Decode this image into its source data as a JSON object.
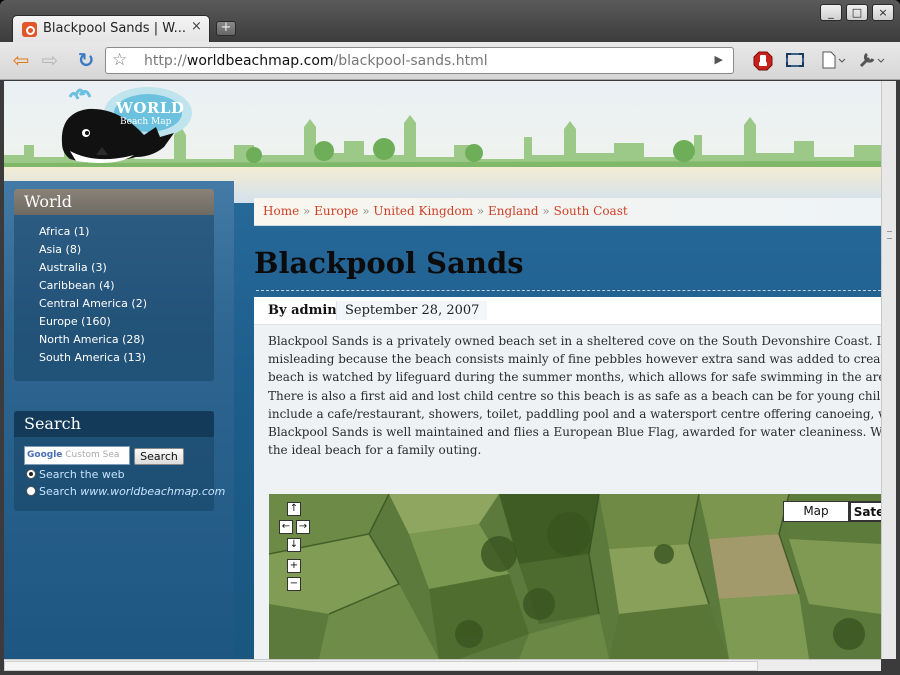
{
  "browser": {
    "tab_title": "Blackpool Sands | W...",
    "tab_close": "×",
    "new_tab": "+",
    "window_controls": [
      "_",
      "□",
      "×"
    ],
    "url_scheme": "http://",
    "url_host": "worldbeachmap.com",
    "url_path": "/blackpool-sands.html",
    "nav": {
      "back": "⇦",
      "forward": "⇨",
      "reload": "↻"
    },
    "toolbar_icons": [
      "adblock-icon",
      "fullscreen-icon",
      "page-menu-icon",
      "wrench-icon"
    ]
  },
  "site": {
    "logo_line1": "WORLD",
    "logo_line2": "Beach Map"
  },
  "sidebar": {
    "world_title": "World",
    "categories": [
      "Africa (1)",
      "Asia (8)",
      "Australia (3)",
      "Caribbean (4)",
      "Central America (2)",
      "Europe (160)",
      "North America (28)",
      "South America (13)"
    ],
    "search_title": "Search",
    "search_placeholder": "Custom Sea",
    "search_brand": "Google",
    "search_button": "Search",
    "radio_web": "Search the web",
    "radio_site_prefix": "Search",
    "radio_site_domain": "www.worldbeachmap.com"
  },
  "breadcrumb": {
    "items": [
      "Home",
      "Europe",
      "United Kingdom",
      "England",
      "South Coast"
    ],
    "separator": "»"
  },
  "post": {
    "title": "Blackpool Sands",
    "author": "By admin",
    "date": "September 28, 2007",
    "body_lines": [
      "Blackpool Sands is a privately owned beach set in a sheltered cove on the South Devonshire Coast. It's name",
      "misleading because the beach consists mainly of fine pebbles however extra sand was added to create a soft",
      "beach is watched by lifeguard during the summer months, which allows for safe swimming in the area up",
      "There is also a first aid and lost child centre so this beach is as safe as a beach can be for young childen. Oth",
      "include a cafe/restaurant, showers, toilet, paddling pool and a watersport centre offering canoeing, windsu",
      "Blackpool Sands is well maintained and flies a European Blue Flag, awarded for water cleaniness. Weather",
      "the ideal beach for a family outing."
    ]
  },
  "map": {
    "controls": {
      "up": "↑",
      "left": "←",
      "right": "→",
      "down": "↓",
      "zoom_in": "+",
      "zoom_out": "−"
    },
    "type_map": "Map",
    "type_satellite": "Sate"
  },
  "colors": {
    "link": "#cf3f25",
    "sidebar_blue": "#1d5781",
    "tab_favicon": "#e2572a"
  }
}
